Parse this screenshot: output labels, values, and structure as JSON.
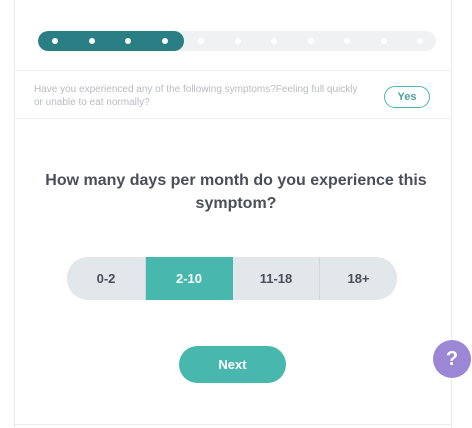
{
  "progress": {
    "completed_steps": 4,
    "total_steps": 11,
    "fraction_complete": 0.36,
    "fill_color": "#2a7f85"
  },
  "previous_answer": {
    "question": "Have you experienced any of the following symptoms?Feeling full quickly or unable to eat normally?",
    "answer": "Yes"
  },
  "question": {
    "text": "How many days per month do you experience this symptom?"
  },
  "options": {
    "items": [
      {
        "label": "0-2",
        "selected": false
      },
      {
        "label": "2-10",
        "selected": true
      },
      {
        "label": "11-18",
        "selected": false
      },
      {
        "label": "18+",
        "selected": false
      }
    ],
    "selected_color": "#48b7ae"
  },
  "actions": {
    "next_label": "Next"
  },
  "help": {
    "label": "?",
    "icon": "help-bubble-icon",
    "color": "#9b87d6"
  }
}
